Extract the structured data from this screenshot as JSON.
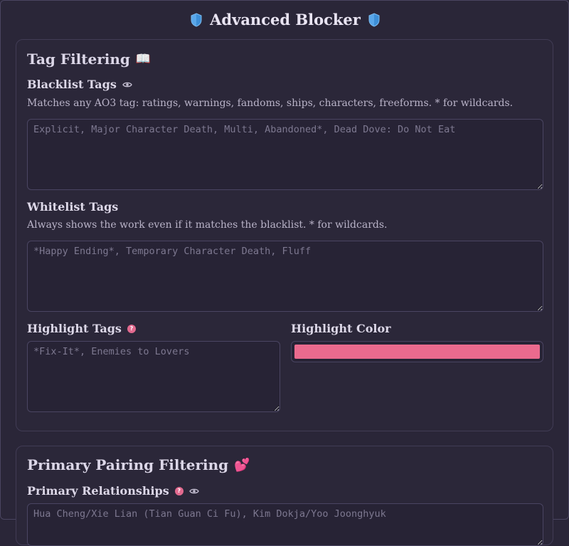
{
  "header": {
    "title": "Advanced Blocker",
    "icon": "shield-icon"
  },
  "tag_filtering": {
    "title": "Tag Filtering",
    "title_emoji": "📖",
    "blacklist": {
      "label": "Blacklist Tags",
      "description": "Matches any AO3 tag: ratings, warnings, fandoms, ships, characters, freeforms. * for wildcards.",
      "placeholder": "Explicit, Major Character Death, Multi, Abandoned*, Dead Dove: Do Not Eat"
    },
    "whitelist": {
      "label": "Whitelist Tags",
      "description": "Always shows the work even if it matches the blacklist. * for wildcards.",
      "placeholder": "*Happy Ending*, Temporary Character Death, Fluff"
    },
    "highlight": {
      "label": "Highlight Tags",
      "placeholder": "*Fix-It*, Enemies to Lovers",
      "help": "?"
    },
    "highlight_color": {
      "label": "Highlight Color",
      "value": "#ea6a8e"
    }
  },
  "pairing_filtering": {
    "title": "Primary Pairing Filtering",
    "title_emoji": "💕",
    "relationships": {
      "label": "Primary Relationships",
      "help": "?",
      "placeholder": "Hua Cheng/Xie Lian (Tian Guan Ci Fu), Kim Dokja/Yoo Joonghyuk"
    }
  },
  "colors": {
    "background": "#2a2638",
    "accent": "#e26a8f",
    "border": "#4a4562"
  }
}
